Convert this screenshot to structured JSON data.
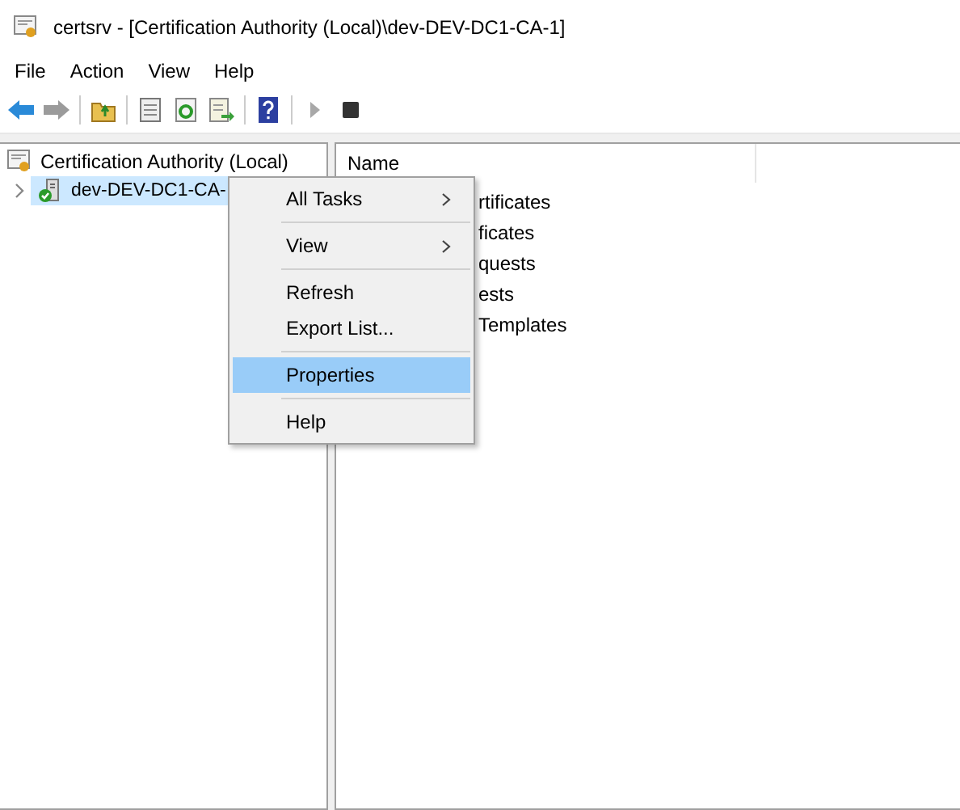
{
  "window": {
    "title": "certsrv - [Certification Authority (Local)\\dev-DEV-DC1-CA-1]"
  },
  "menu_bar": [
    "File",
    "Action",
    "View",
    "Help"
  ],
  "toolbar": [
    {
      "kind": "back",
      "disabled": false
    },
    {
      "kind": "forward",
      "disabled": true
    },
    {
      "kind": "sep"
    },
    {
      "kind": "up",
      "disabled": false
    },
    {
      "kind": "sep"
    },
    {
      "kind": "properties",
      "disabled": false
    },
    {
      "kind": "refresh",
      "disabled": false
    },
    {
      "kind": "export",
      "disabled": false
    },
    {
      "kind": "sep"
    },
    {
      "kind": "help",
      "disabled": false
    },
    {
      "kind": "sep"
    },
    {
      "kind": "play",
      "disabled": true
    },
    {
      "kind": "stop",
      "disabled": false
    }
  ],
  "tree": [
    {
      "label": "Certification Authority (Local)",
      "kind": "root",
      "selected": false,
      "children": [
        {
          "label": "dev-DEV-DC1-CA-",
          "kind": "ca",
          "selected": true,
          "expanded": false
        }
      ]
    }
  ],
  "list": {
    "columns": [
      "Name"
    ],
    "rows": [
      "rtificates",
      "ficates",
      "quests",
      "ests",
      "Templates"
    ]
  },
  "context_menu": [
    {
      "label": "All Tasks",
      "submenu": true,
      "selected": false
    },
    {
      "kind": "sep"
    },
    {
      "label": "View",
      "submenu": true,
      "selected": false
    },
    {
      "kind": "sep"
    },
    {
      "label": "Refresh",
      "submenu": false,
      "selected": false
    },
    {
      "label": "Export List...",
      "submenu": false,
      "selected": false
    },
    {
      "kind": "sep"
    },
    {
      "label": "Properties",
      "submenu": false,
      "selected": true
    },
    {
      "kind": "sep"
    },
    {
      "label": "Help",
      "submenu": false,
      "selected": false
    }
  ]
}
